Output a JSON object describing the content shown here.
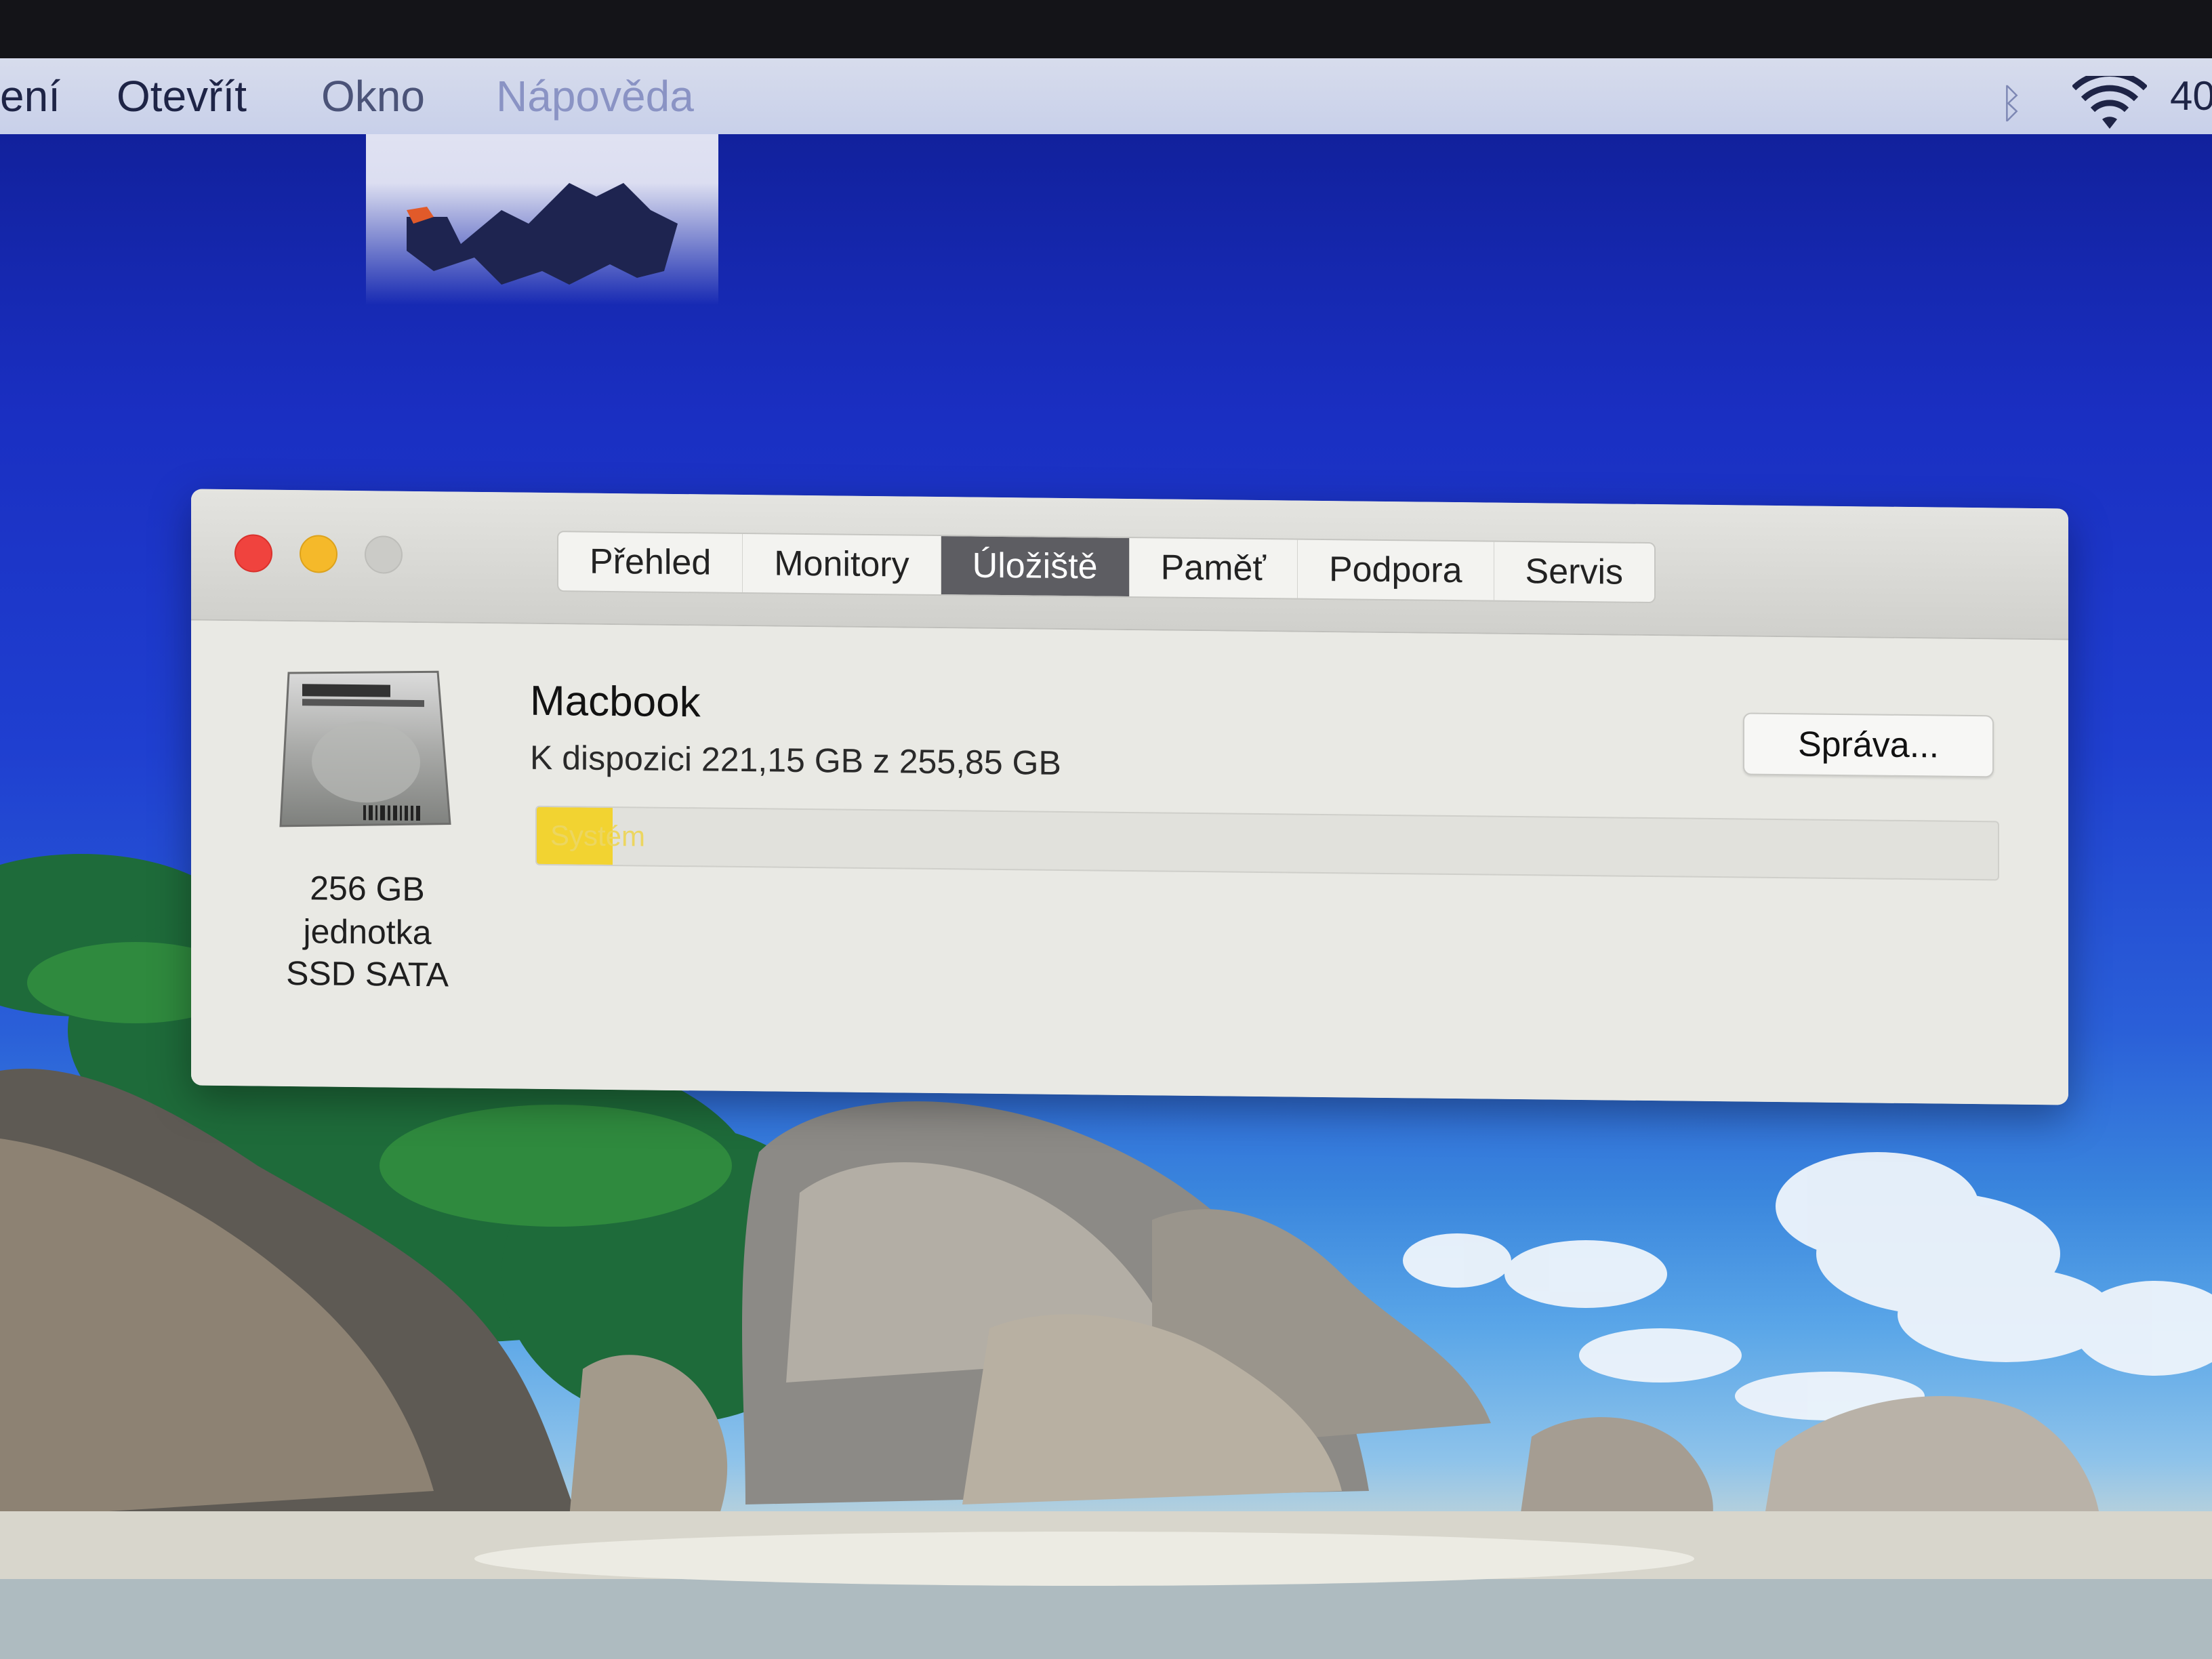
{
  "menubar": {
    "items": [
      {
        "label": "ení"
      },
      {
        "label": "Otevřít"
      },
      {
        "label": "Okno"
      },
      {
        "label": "Nápověda"
      }
    ],
    "status": {
      "battery_text": "40"
    }
  },
  "window": {
    "tabs": [
      {
        "label": "Přehled",
        "active": false
      },
      {
        "label": "Monitory",
        "active": false
      },
      {
        "label": "Úložiště",
        "active": true
      },
      {
        "label": "Paměť",
        "active": false
      },
      {
        "label": "Podpora",
        "active": false
      },
      {
        "label": "Servis",
        "active": false
      }
    ],
    "disk": {
      "line1": "256 GB",
      "line2": "jednotka",
      "line3": "SSD SATA"
    },
    "volume": {
      "name": "Macbook",
      "available_text": "K dispozici 221,15 GB z 255,85 GB",
      "manage_label": "Správa...",
      "segments": [
        {
          "label": "Systém",
          "color": "#f2d331",
          "fraction": 0.052
        }
      ]
    }
  },
  "colors": {
    "close": "#f0433e",
    "minimize": "#f5b92a",
    "zoom": "#cbcbc7",
    "active_tab": "#5d5d62"
  }
}
